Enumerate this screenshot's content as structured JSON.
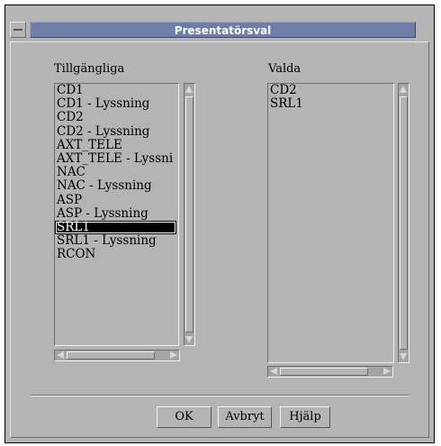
{
  "window": {
    "title": "Presentatörsval"
  },
  "available": {
    "label": "Tillgängliga",
    "items": [
      "CD1",
      "CD1 - Lyssning",
      "CD2",
      "CD2 - Lyssning",
      "AXT_TELE",
      "AXT_TELE - Lyssni",
      "NAC",
      "NAC - Lyssning",
      "ASP",
      "ASP - Lyssning",
      "SRL1",
      "SRL1 - Lyssning",
      "RCON"
    ],
    "selected": "SRL1"
  },
  "selected_list": {
    "label": "Valda",
    "items": [
      "CD2",
      "SRL1"
    ]
  },
  "buttons": {
    "ok": "OK",
    "cancel": "Avbryt",
    "help": "Hjälp"
  },
  "colors": {
    "background": "#b4b4b4",
    "titlebar": "#6e7ea6",
    "selection": "#000000"
  }
}
